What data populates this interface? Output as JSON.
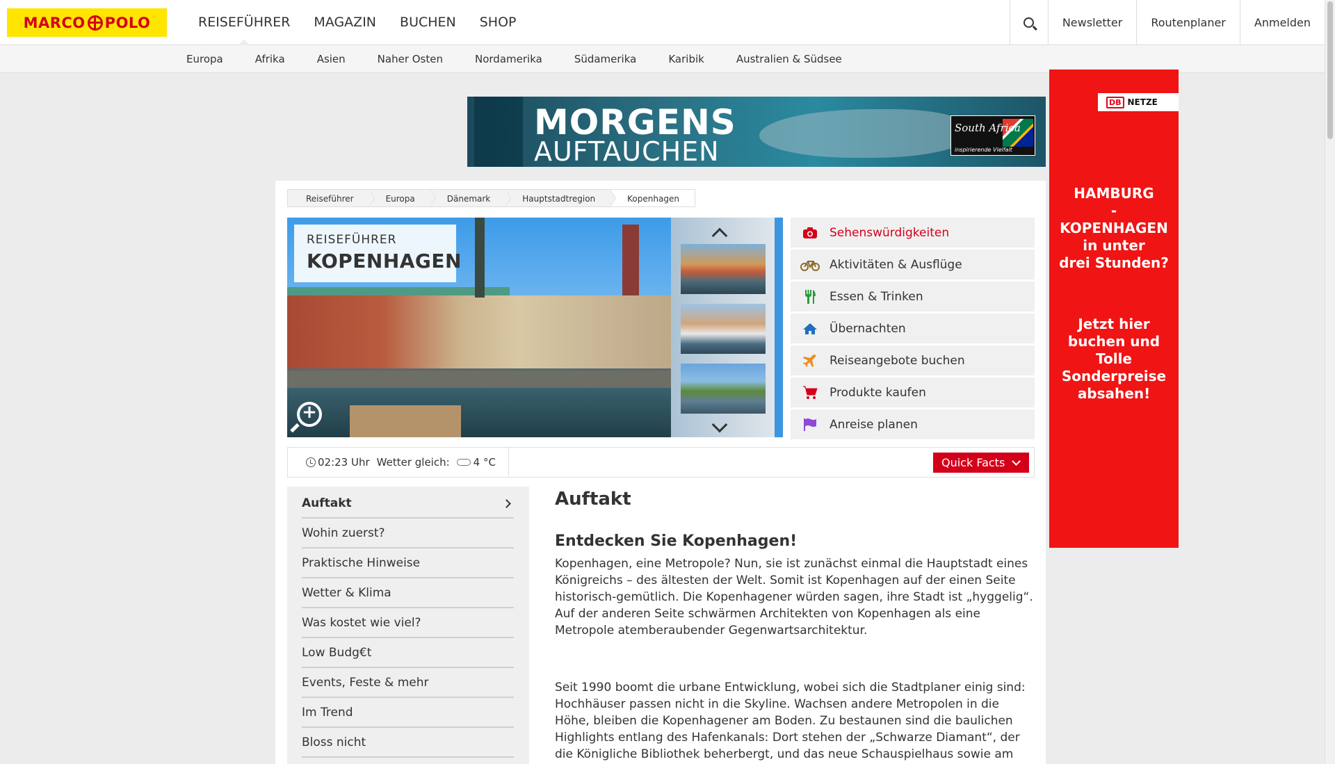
{
  "logo": {
    "left": "MARCO",
    "right": "POLO"
  },
  "mainnav": [
    "REISEFÜHRER",
    "MAGAZIN",
    "BUCHEN",
    "SHOP"
  ],
  "rightnav": {
    "newsletter": "Newsletter",
    "routenplaner": "Routenplaner",
    "anmelden": "Anmelden"
  },
  "subnav": [
    "Europa",
    "Afrika",
    "Asien",
    "Naher Osten",
    "Nordamerika",
    "Südamerika",
    "Karibik",
    "Australien & Südsee"
  ],
  "banner": {
    "line1": "MORGENS",
    "line2": "AUFTAUCHEN",
    "brand": "South Africa",
    "tagline": "inspirierende Vielfalt"
  },
  "side_ad": {
    "logo_mark": "DB",
    "logo_text": "NETZE",
    "headline": [
      "HAMBURG",
      "-",
      "KOPENHAGEN",
      "in unter",
      "drei Stunden?"
    ],
    "cta": [
      "Jetzt hier",
      "buchen und",
      "Tolle",
      "Sonderpreise",
      "absahen!"
    ]
  },
  "breadcrumb": [
    "Reiseführer",
    "Europa",
    "Dänemark",
    "Hauptstadtregion",
    "Kopenhagen"
  ],
  "hero": {
    "kicker": "REISEFÜHRER",
    "title": "KOPENHAGEN"
  },
  "topics": [
    {
      "label": "Sehenswürdigkeiten",
      "icon": "camera-icon",
      "color": "#d4001a",
      "active": true
    },
    {
      "label": "Aktivitäten & Ausflüge",
      "icon": "bicycle-icon",
      "color": "#8a6d2b"
    },
    {
      "label": "Essen & Trinken",
      "icon": "fork-knife-icon",
      "color": "#2c9a3c"
    },
    {
      "label": "Übernachten",
      "icon": "house-icon",
      "color": "#1f6fc1"
    },
    {
      "label": "Reiseangebote buchen",
      "icon": "plane-icon",
      "color": "#f08c1e"
    },
    {
      "label": "Produkte kaufen",
      "icon": "cart-icon",
      "color": "#d4001a"
    },
    {
      "label": "Anreise planen",
      "icon": "flag-icon",
      "color": "#8c4ad6"
    }
  ],
  "infobar": {
    "time": "02:23 Uhr",
    "weather_label": "Wetter gleich:",
    "temperature": "4 °C",
    "quickfacts": "Quick Facts"
  },
  "leftnav": [
    "Auftakt",
    "Wohin zuerst?",
    "Praktische Hinweise",
    "Wetter & Klima",
    "Was kostet wie viel?",
    "Low Budg€t",
    "Events, Feste & mehr",
    "Im Trend",
    "Bloss nicht"
  ],
  "article": {
    "heading": "Auftakt",
    "subheading": "Entdecken Sie Kopenhagen!",
    "p1": "Kopenhagen, eine Metropole? Nun, sie ist zunächst einmal die Hauptstadt eines Königreichs – des ältesten der Welt. Somit ist Kopenhagen auf der einen Seite historisch-gemütlich. Die Kopenhagener würden sagen, ihre Stadt ist „hyggelig“. Auf der anderen Seite schwärmen Architekten von Kopenhagen als eine Metropole atemberaubender Gegenwartsarchitektur.",
    "p2": "Seit 1990 boomt die urbane Entwicklung, wobei sich die Stadtplaner einig sind: Hochhäuser passen nicht in die Skyline. Wachsen andere Metropolen in die Höhe, bleiben die Kopenhagener am Boden. Zu bestaunen sind die baulichen Highlights entlang des Hafenkanals: Dort stehen der „Schwarze Diamant“, der die Königliche Bibliothek beherbergt, und das neue Schauspielhaus sowie am"
  },
  "colors": {
    "brand_yellow": "#ffe500",
    "brand_red": "#d4001a",
    "ad_red": "#f01414"
  }
}
